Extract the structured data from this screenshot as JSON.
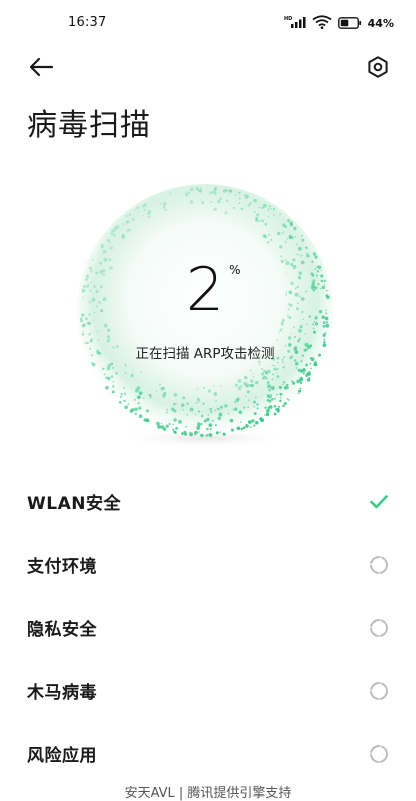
{
  "status_bar": {
    "time": "16:37",
    "battery_percent": "44%",
    "icons": [
      "hd-signal-icon",
      "wifi-icon",
      "battery-icon"
    ]
  },
  "nav": {
    "back_icon": "arrow-left-icon",
    "settings_icon": "hexagon-settings-icon"
  },
  "title": "病毒扫描",
  "scan": {
    "percent_value": "2",
    "percent_unit": "%",
    "status_text": "正在扫描 ARP攻击检测",
    "progress": 0.02
  },
  "checks": [
    {
      "label": "WLAN安全",
      "state": "done"
    },
    {
      "label": "支付环境",
      "state": "pending"
    },
    {
      "label": "隐私安全",
      "state": "pending"
    },
    {
      "label": "木马病毒",
      "state": "pending"
    },
    {
      "label": "风险应用",
      "state": "pending"
    }
  ],
  "footer": "安天AVL | 腾讯提供引擎支持",
  "colors": {
    "accent_green": "#3ec98a",
    "pending_gray": "#bdbdbd"
  }
}
